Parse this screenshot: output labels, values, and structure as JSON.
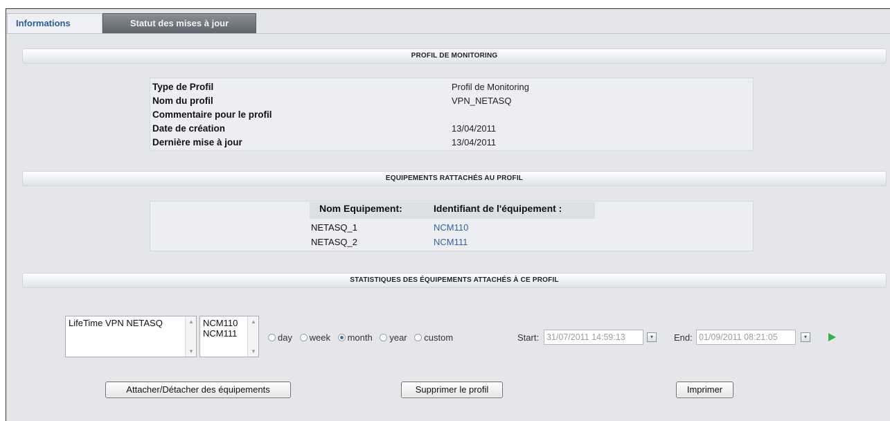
{
  "tabs": {
    "informations": "Informations",
    "statut": "Statut des mises à jour"
  },
  "sections": {
    "profil": "PROFIL DE MONITORING",
    "equipements": "EQUIPEMENTS RATTACHÉS AU PROFIL",
    "statistiques": "STATISTIQUES DES ÉQUIPEMENTS ATTACHÉS À CE PROFIL"
  },
  "profile_info": [
    {
      "label": "Type de Profil",
      "value": "Profil de Monitoring"
    },
    {
      "label": "Nom du profil",
      "value": "VPN_NETASQ"
    },
    {
      "label": "Commentaire pour le profil",
      "value": ""
    },
    {
      "label": "Date de création",
      "value": "13/04/2011"
    },
    {
      "label": "Dernière mise à jour",
      "value": "13/04/2011"
    }
  ],
  "equipments": {
    "headers": [
      "Nom Equipement:",
      "Identifiant de l'équipement :"
    ],
    "rows": [
      {
        "name": "NETASQ_1",
        "id": "NCM110"
      },
      {
        "name": "NETASQ_2",
        "id": "NCM111"
      }
    ]
  },
  "stats": {
    "graph_list": [
      "LifeTime VPN NETASQ"
    ],
    "device_list": [
      "NCM110",
      "NCM111"
    ],
    "periods": [
      "day",
      "week",
      "month",
      "year",
      "custom"
    ],
    "selected_period": "month",
    "start_label": "Start:",
    "start_value": "31/07/2011 14:59:13",
    "end_label": "End:",
    "end_value": "01/09/2011 08:21:05"
  },
  "buttons": {
    "attach": "Attacher/Détacher des équipements",
    "delete": "Supprimer le profil",
    "print": "Imprimer"
  },
  "colors": {
    "accent": "#2b5d9c",
    "link": "#2e63a8",
    "go": "#38b04a",
    "panel_bg": "#e4e6ea"
  }
}
